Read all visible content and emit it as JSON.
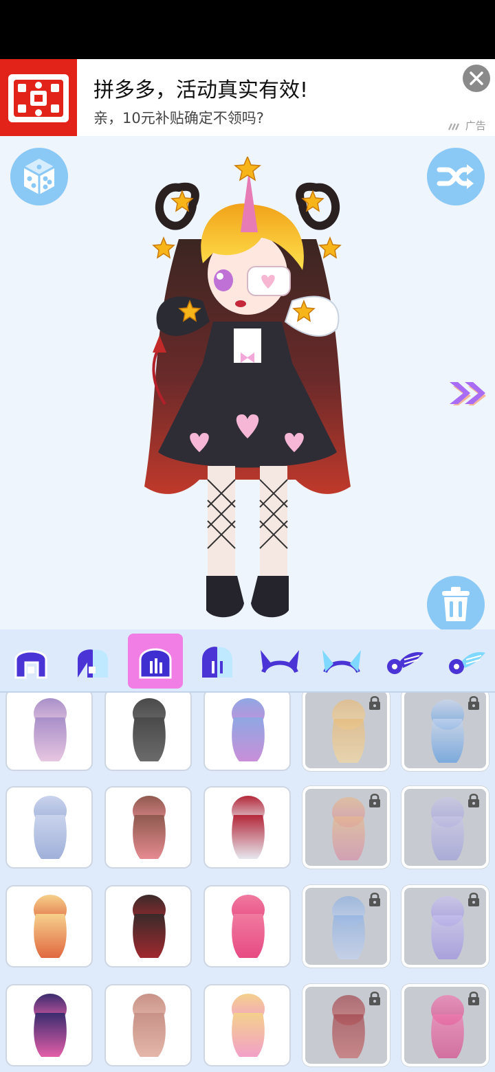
{
  "ad": {
    "title": "拼多多，活动真实有效!",
    "subtitle": "亲，10元补贴确定不领吗?",
    "tag": "广告",
    "brand_color": "#e2231a"
  },
  "toolbar": {
    "dice_icon": "dice-icon",
    "shuffle_icon": "shuffle-icon",
    "delete_icon": "trash-icon",
    "next_icon": "double-chevron-right-icon"
  },
  "categories": [
    {
      "name": "front-hair",
      "selected": false
    },
    {
      "name": "front-hair-alt",
      "selected": false
    },
    {
      "name": "back-hair",
      "selected": true
    },
    {
      "name": "back-hair-alt",
      "selected": false
    },
    {
      "name": "horns",
      "selected": false
    },
    {
      "name": "horns-alt",
      "selected": false
    },
    {
      "name": "wings",
      "selected": false
    },
    {
      "name": "wings-alt",
      "selected": false
    }
  ],
  "items": [
    {
      "colors": [
        "#a78fc9",
        "#e7c6e0"
      ],
      "locked": false
    },
    {
      "colors": [
        "#4a4a4a",
        "#6b6b6b"
      ],
      "locked": false
    },
    {
      "colors": [
        "#8fa7e3",
        "#c98fd8"
      ],
      "locked": false
    },
    {
      "colors": [
        "#e6b97a",
        "#f4d7a1"
      ],
      "locked": true
    },
    {
      "colors": [
        "#c9d7ef",
        "#5c9be0"
      ],
      "locked": true
    },
    {
      "colors": [
        "#c9d3ec",
        "#9fb0d9"
      ],
      "locked": false
    },
    {
      "colors": [
        "#8f5a4f",
        "#e58a90"
      ],
      "locked": false
    },
    {
      "colors": [
        "#b3283a",
        "#e7e7ee"
      ],
      "locked": false
    },
    {
      "colors": [
        "#e6b98f",
        "#d68fa7"
      ],
      "locked": true
    },
    {
      "colors": [
        "#c9c7e6",
        "#9e9fd9"
      ],
      "locked": true
    },
    {
      "colors": [
        "#f6d08c",
        "#e06840"
      ],
      "locked": false
    },
    {
      "colors": [
        "#3a2a2a",
        "#a0292f"
      ],
      "locked": false
    },
    {
      "colors": [
        "#f07aa0",
        "#e74b82"
      ],
      "locked": false
    },
    {
      "colors": [
        "#8fb0e0",
        "#c3d2ef"
      ],
      "locked": true
    },
    {
      "colors": [
        "#c8c3ee",
        "#9b8fe0"
      ],
      "locked": true
    },
    {
      "colors": [
        "#3a2c6e",
        "#e35ea8"
      ],
      "locked": false
    },
    {
      "colors": [
        "#c89287",
        "#e4b6a9"
      ],
      "locked": false
    },
    {
      "colors": [
        "#f4d08c",
        "#f2a0c8"
      ],
      "locked": false
    },
    {
      "colors": [
        "#a0454d",
        "#c76a6a"
      ],
      "locked": true
    },
    {
      "colors": [
        "#f07ab0",
        "#d64a8a"
      ],
      "locked": true
    }
  ]
}
